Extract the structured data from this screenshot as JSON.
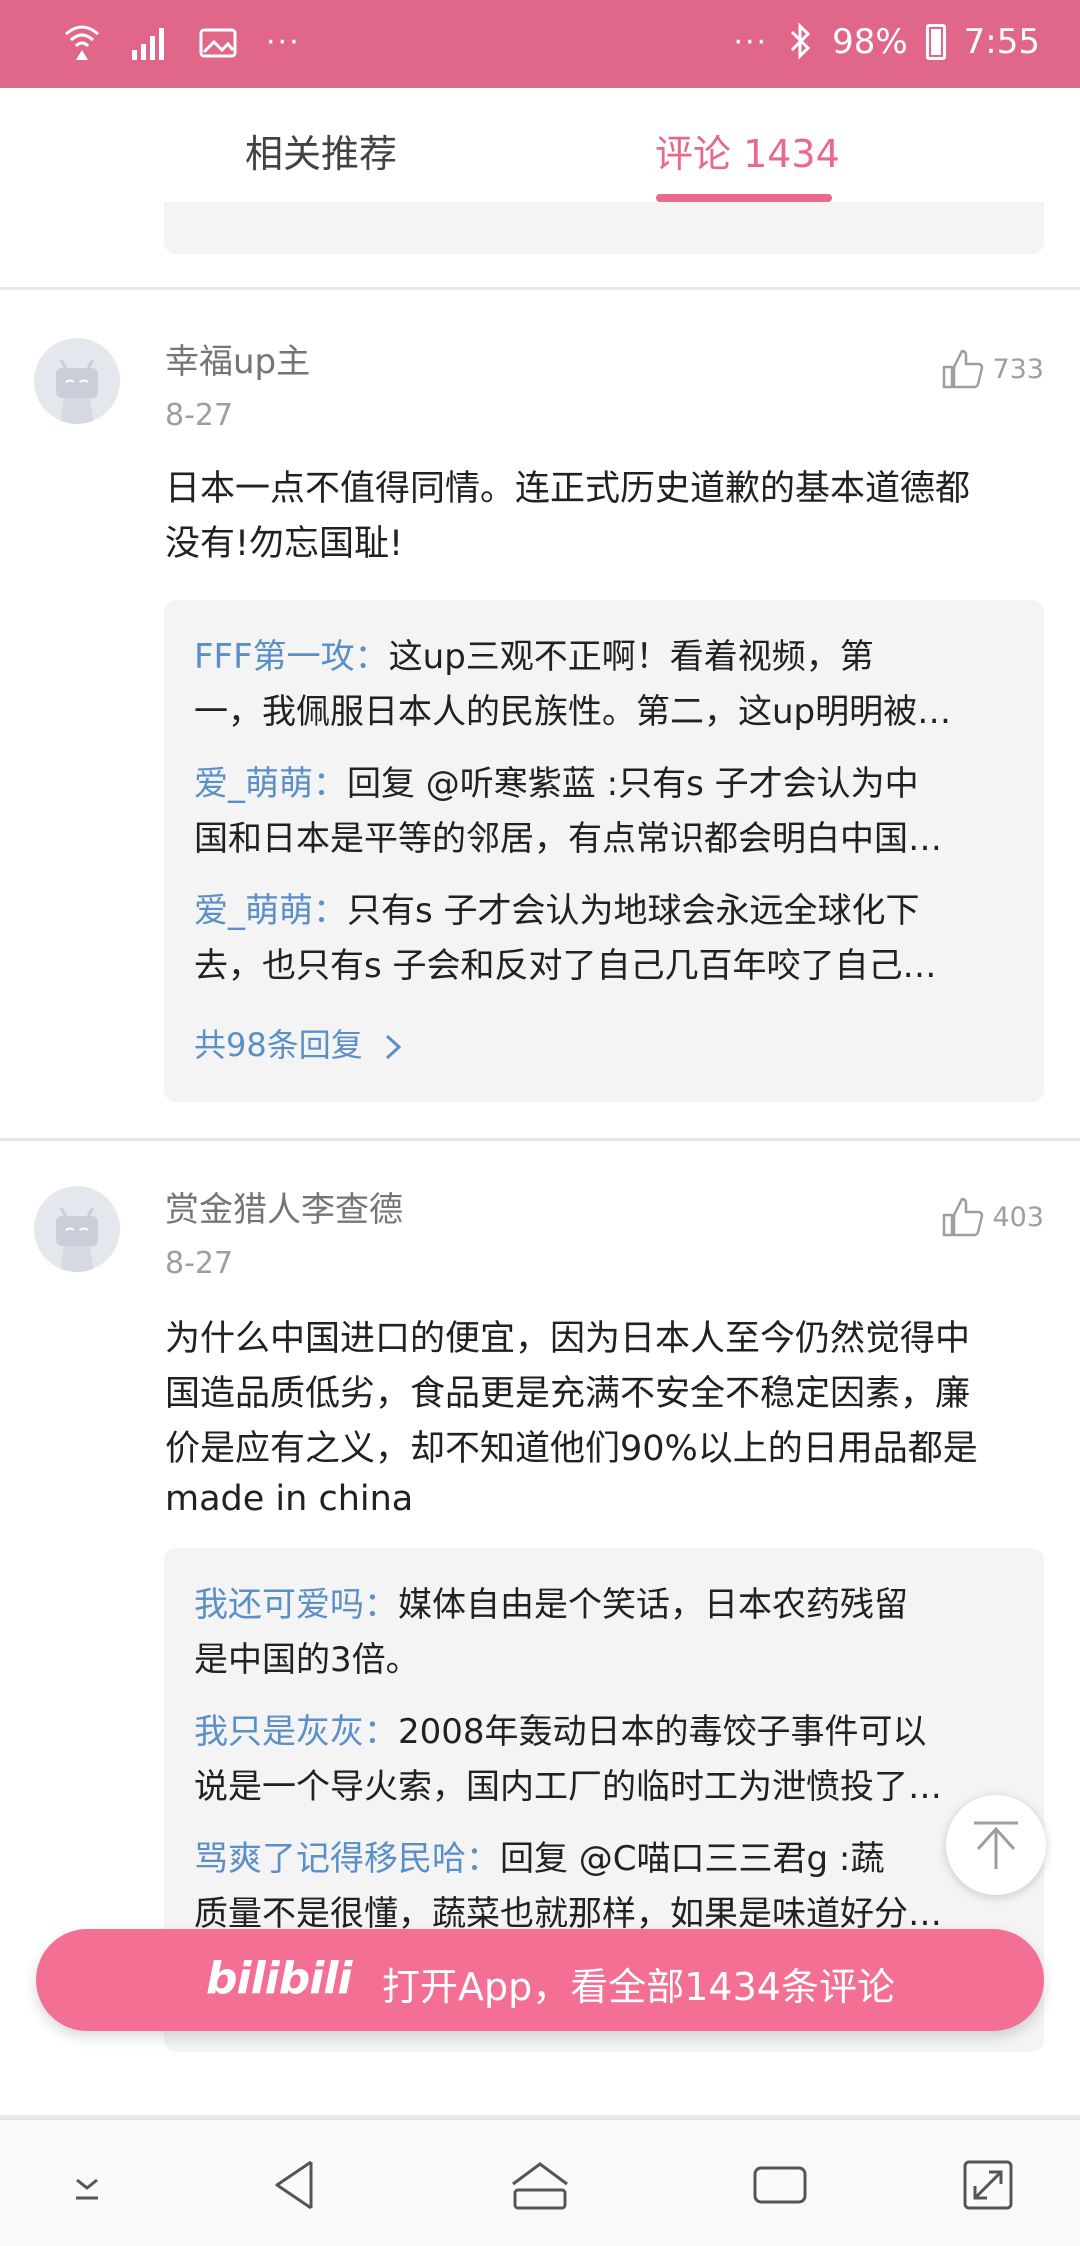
{
  "status_bar": {
    "dots_left": "···",
    "dots_right": "···",
    "battery": "98%",
    "time": "7:55"
  },
  "tabs": {
    "related": "相关推荐",
    "comments": "评论 1434"
  },
  "comments": [
    {
      "username": "幸福up主",
      "date": "8-27",
      "likes": "733",
      "text_line1": "日本一点不值得同情。连正式历史道歉的基本道德都",
      "text_line2": "没有!勿忘国耻!",
      "replies": [
        {
          "name": "FFF第一攻：",
          "line1": "这up三观不正啊！看着视频，第",
          "line2": "一，我佩服日本人的民族性。第二，这up明明被…"
        },
        {
          "name": "爱_萌萌：",
          "line1": "回复 @听寒紫蓝 :只有s 子才会认为中",
          "line2": "国和日本是平等的邻居，有点常识都会明白中国…"
        },
        {
          "name": "爱_萌萌：",
          "line1": "只有s 子才会认为地球会永远全球化下",
          "line2": "去，也只有s 子会和反对了自己几百年咬了自己…"
        }
      ],
      "more_replies": "共98条回复"
    },
    {
      "username": "赏金猎人李查德",
      "date": "8-27",
      "likes": "403",
      "text_line1": "为什么中国进口的便宜，因为日本人至今仍然觉得中",
      "text_line2": "国造品质低劣，食品更是充满不安全不稳定因素，廉",
      "text_line3": "价是应有之义，却不知道他们90%以上的日用品都是",
      "text_line4": "made in china",
      "replies": [
        {
          "name": "我还可爱吗：",
          "line1": "媒体自由是个笑话，日本农药残留",
          "line2": "是中国的3倍。"
        },
        {
          "name": "我只是灰灰：",
          "line1": "2008年轰动日本的毒饺子事件可以",
          "line2": "说是一个导火索，国内工厂的临时工为泄愤投了…"
        },
        {
          "name": "骂爽了记得移民哈：",
          "line1": "回复 @C喵口三三君g :蔬",
          "line2": "质量不是很懂，蔬菜也就那样，如果是味道好分…"
        }
      ]
    }
  ],
  "open_app": {
    "logo": "bilibili",
    "label": "打开App，看全部1434条评论"
  },
  "icons": {
    "wifi": "wifi-icon",
    "signal": "signal-icon",
    "image": "image-icon",
    "bluetooth": "bluetooth-icon",
    "battery": "battery-icon",
    "like": "thumbs-up-icon",
    "to_top": "back-to-top-icon"
  },
  "colors": {
    "status_bar": "#e0678a",
    "accent": "#e8688e",
    "reply_name": "#5b8fc7",
    "open_app": "#f36f93"
  }
}
